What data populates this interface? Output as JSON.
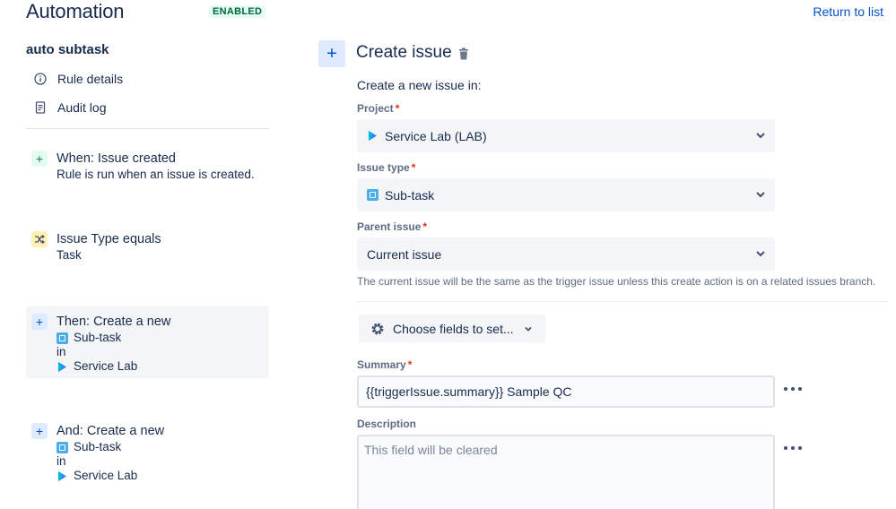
{
  "header": {
    "title": "Automation",
    "status": "ENABLED",
    "return_link": "Return to list"
  },
  "sidebar": {
    "rule_name": "auto subtask",
    "links": [
      {
        "label": "Rule details",
        "icon": "info-icon"
      },
      {
        "label": "Audit log",
        "icon": "document-icon"
      }
    ],
    "steps": [
      {
        "title": "When: Issue created",
        "sub": "Rule is run when an issue is created.",
        "icon": "plus-icon"
      },
      {
        "title": "Issue Type equals",
        "sub": "Task",
        "icon": "shuffle-icon"
      },
      {
        "title": "Then: Create a new",
        "issue_type": "Sub-task",
        "in": "in",
        "project": "Service Lab",
        "icon": "plus-icon"
      },
      {
        "title": "And: Create a new",
        "issue_type": "Sub-task",
        "in": "in",
        "project": "Service Lab",
        "icon": "plus-icon"
      }
    ]
  },
  "panel": {
    "title": "Create issue",
    "intro": "Create a new issue in:",
    "project": {
      "label": "Project",
      "required": "*",
      "value": "Service Lab (LAB)"
    },
    "issue_type": {
      "label": "Issue type",
      "required": "*",
      "value": "Sub-task"
    },
    "parent_issue": {
      "label": "Parent issue",
      "required": "*",
      "value": "Current issue",
      "helper": "The current issue will be the same as the trigger issue unless this create action is on a related issues branch."
    },
    "choose_fields": "Choose fields to set...",
    "summary": {
      "label": "Summary",
      "required": "*",
      "value": "{{triggerIssue.summary}} Sample QC"
    },
    "description": {
      "label": "Description",
      "placeholder": "This field will be cleared"
    }
  },
  "colors": {
    "accent": "#0052cc",
    "enabled_bg": "#e3fcef",
    "enabled_text": "#006644",
    "required": "#de350b"
  }
}
